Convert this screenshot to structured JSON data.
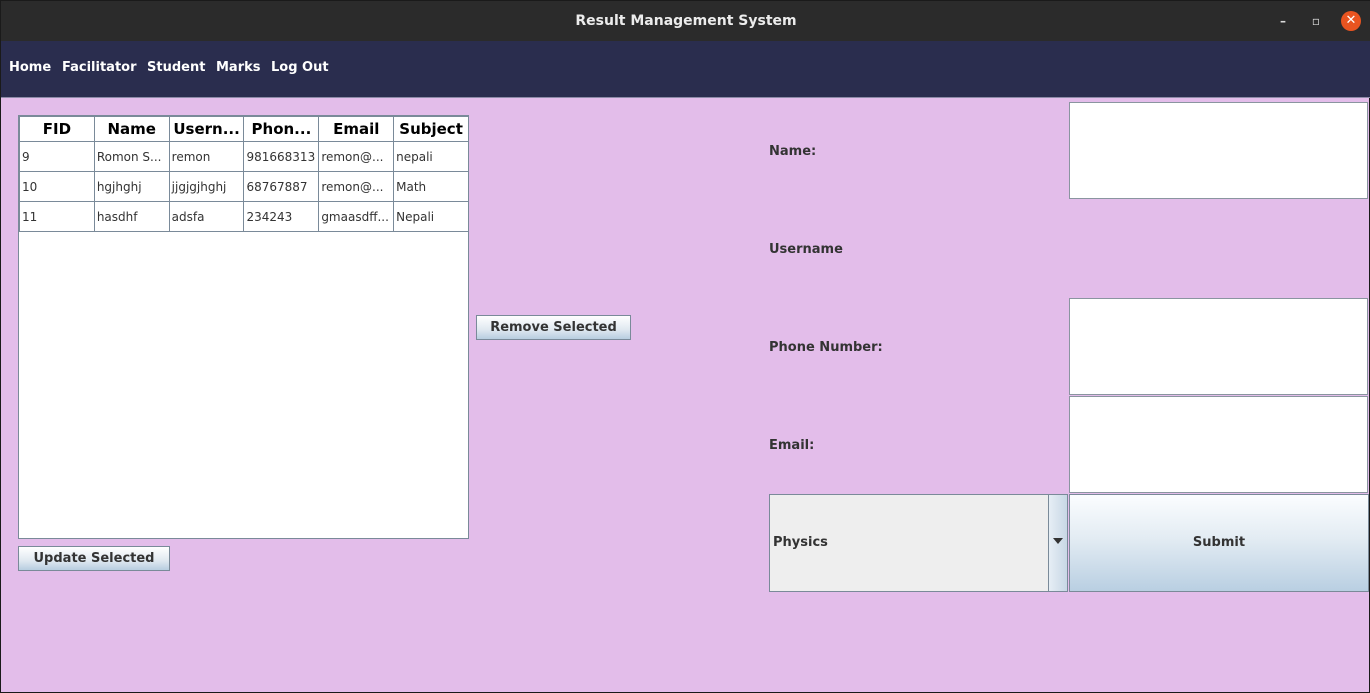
{
  "window": {
    "title": "Result Management System",
    "controls": {
      "minimize": "–",
      "maximize": "▫",
      "close": "✕"
    }
  },
  "menu": {
    "items": [
      "Home",
      "Facilitator",
      "Student",
      "Marks",
      "Log Out"
    ]
  },
  "table": {
    "columns": [
      "FID",
      "Name",
      "Usern...",
      "Phon...",
      "Email",
      "Subject"
    ],
    "rows": [
      [
        "9",
        "Romon S...",
        "remon",
        "981668313",
        "remon@...",
        "nepali"
      ],
      [
        "10",
        "hgjhghj",
        "jjgjgjhghj",
        "68767887",
        "remon@...",
        "Math"
      ],
      [
        "11",
        "hasdhf",
        "adsfa",
        "234243",
        "gmaasdff...",
        "Nepali"
      ]
    ]
  },
  "buttons": {
    "update_selected": "Update Selected",
    "remove_selected": "Remove Selected",
    "submit": "Submit"
  },
  "form": {
    "name_label": "Name:",
    "username_label": "Username",
    "phone_label": "Phone Number:",
    "email_label": "Email:",
    "subject_selected": "Physics"
  },
  "colors": {
    "background": "#e3bdea",
    "menubar": "#2a2d4e",
    "titlebar": "#2b2b2b",
    "close_button": "#e95420"
  },
  "icons": {
    "dropdown": "chevron-down-icon"
  }
}
